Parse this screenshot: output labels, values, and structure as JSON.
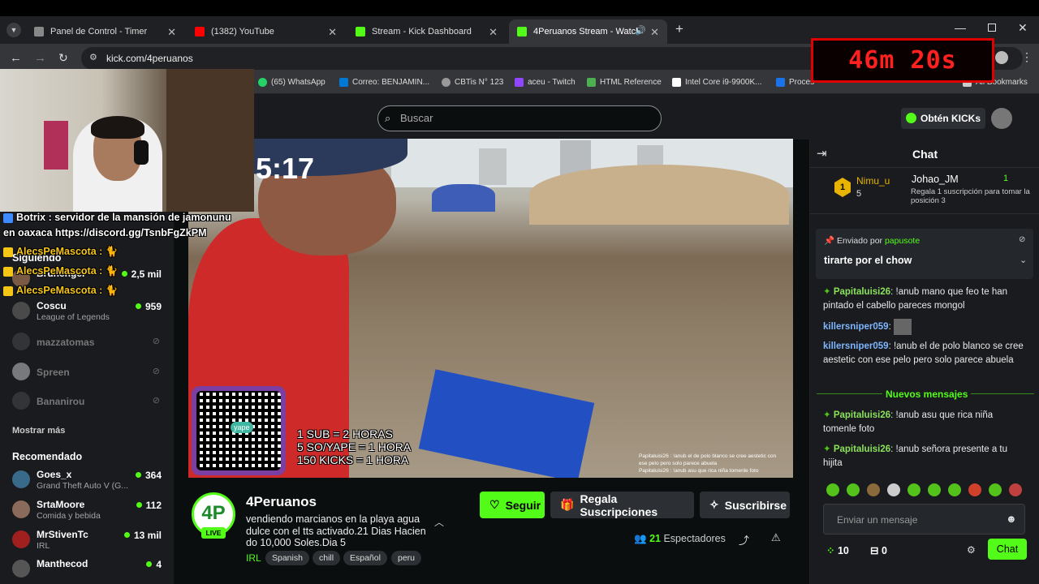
{
  "tabs": [
    {
      "title": "Panel de Control - Timer",
      "color": "#888"
    },
    {
      "title": "(1382) YouTube",
      "color": "#ff0000"
    },
    {
      "title": "Stream - Kick Dashboard",
      "color": "#53fc18"
    },
    {
      "title": "4Peruanos Stream - Watch",
      "color": "#53fc18"
    }
  ],
  "address": "kick.com/4peruanos",
  "bookmarks": [
    {
      "label": "(65) WhatsApp",
      "color": "#25d366"
    },
    {
      "label": "Correo: BENJAMIN...",
      "color": "#0078d4"
    },
    {
      "label": "CBTis N° 123",
      "color": "#999"
    },
    {
      "label": "aceu - Twitch",
      "color": "#9146ff"
    },
    {
      "label": "HTML Reference",
      "color": "#4caf50"
    },
    {
      "label": "Intel Core i9-9900K...",
      "color": "#fff"
    },
    {
      "label": "Proces",
      "color": "#1a73e8"
    },
    {
      "label": "All Bookmarks",
      "color": "#ccc"
    }
  ],
  "search_placeholder": "Buscar",
  "get_kicks": "Obtén KICKs",
  "sidebar": {
    "following_title": "Siguiendo",
    "following": [
      {
        "name": "Brunenger",
        "category": "",
        "viewers": "2,5 mil",
        "live": true
      },
      {
        "name": "Coscu",
        "category": "League of Legends",
        "viewers": "959",
        "live": true
      },
      {
        "name": "mazzatomas",
        "category": "",
        "viewers": "",
        "live": false
      },
      {
        "name": "Spreen",
        "category": "",
        "viewers": "",
        "live": false
      },
      {
        "name": "Bananirou",
        "category": "",
        "viewers": "",
        "live": false
      }
    ],
    "show_more": "Mostrar más",
    "recommended_title": "Recomendado",
    "recommended": [
      {
        "name": "Goes_x",
        "category": "Grand Theft Auto V (G...",
        "viewers": "364"
      },
      {
        "name": "SrtaMoore",
        "category": "Comida y bebida",
        "viewers": "112"
      },
      {
        "name": "MrStivenTc",
        "category": "IRL",
        "viewers": "13 mil"
      },
      {
        "name": "Manthecod",
        "category": "",
        "viewers": "4"
      }
    ]
  },
  "video": {
    "clock": "5:17",
    "promo_lines": [
      "1 SUB = 2 HORAS",
      "5 SO/YAPE = 1 HORA",
      "150 KICKS = 1 HORA"
    ],
    "qr_label": "yape"
  },
  "stream": {
    "channel": "4Peruanos",
    "live_badge": "LIVE",
    "title": "vendiendo marcianos en la playa agua dulce con el tts activado.21 Dias Hacien do 10,000 Soles.Dia 5",
    "category": "IRL",
    "tags": [
      "Spanish",
      "chill",
      "Español",
      "peru"
    ],
    "follow": "Seguir",
    "gift": "Regala Suscripciones",
    "subscribe": "Suscribirse",
    "viewers_count": "21",
    "viewers_label": "Espectadores"
  },
  "chat": {
    "title": "Chat",
    "leader1": {
      "rank": "1",
      "name": "Nimu_u",
      "count": "5"
    },
    "leader2": {
      "name": "Johao_JM",
      "count": "1",
      "cta": "Regala 1 suscripción para tomar la posición 3"
    },
    "pinned_by_label": "Enviado por",
    "pinned_by": "papusote",
    "pinned_text": "tirarte por el chow",
    "messages": [
      {
        "user": "Papitaluisi26",
        "text": ": !anub mano que feo te han pintado el cabello pareces mongol"
      },
      {
        "user": "killersniper059",
        "text": ":"
      },
      {
        "user": "killersniper059",
        "text": ": !anub el de polo blanco se cree aestetic con ese pelo pero solo parece abuela"
      }
    ],
    "new_messages": "Nuevos mensajes",
    "new": [
      {
        "user": "Papitaluisi26",
        "text": ": !anub asu que rica niña tomenle foto"
      },
      {
        "user": "Papitaluisi26",
        "text": ": !anub señora presente a tu hijita"
      }
    ],
    "input_placeholder": "Enviar un mensaje",
    "kicks_count": "10",
    "gifts_count": "0",
    "send": "Chat"
  },
  "overlay": {
    "timer": "46m 20s",
    "bot_line1": "Botrix : servidor de la mansión de jamonunu",
    "bot_line2": "en oaxaca https://discord.gg/TsnbFgZkPM",
    "alerts": [
      "AlecsPeMascota :",
      "AlecsPeMascota :",
      "AlecsPeMascota :"
    ],
    "bottom_text1": "Papitaluisi26 : !anub el de polo blanco se cree aestetic con",
    "bottom_text2": "ese pelo pero solo parece abuela",
    "bottom_text3": "Papitaluisi26 : !anub asu que rica niña tomenle foto"
  }
}
